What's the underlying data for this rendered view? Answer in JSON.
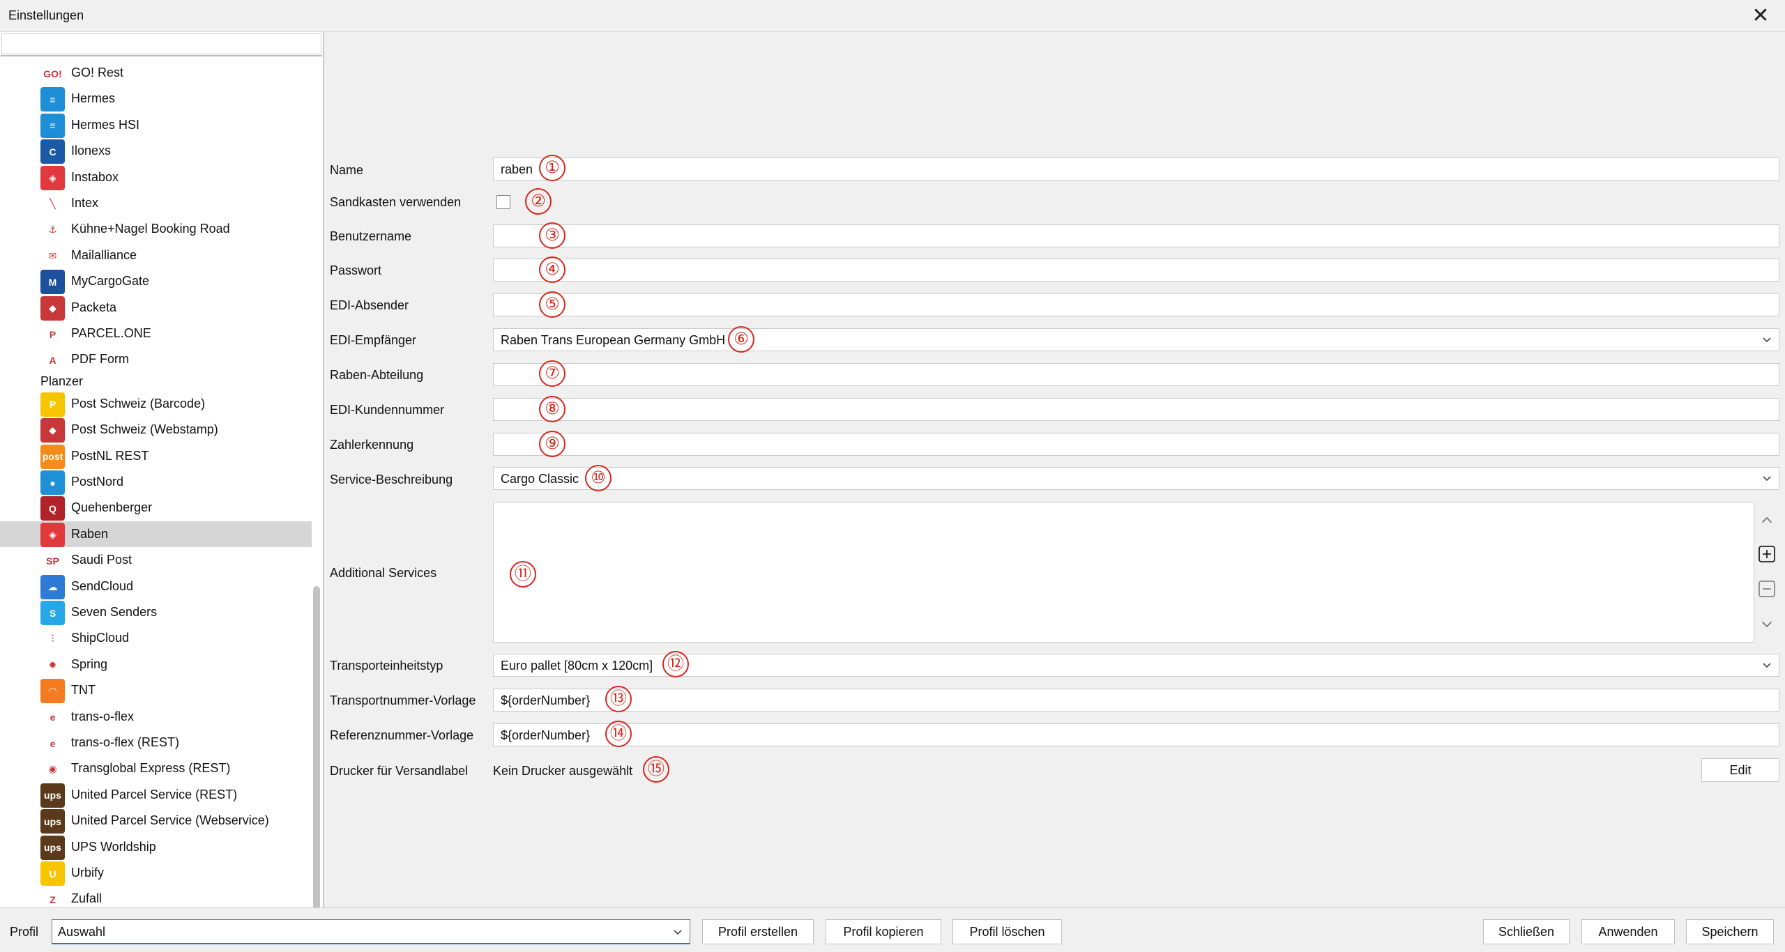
{
  "window": {
    "title": "Einstellungen",
    "close_glyph": "✕"
  },
  "sidebar": {
    "items": [
      {
        "label": "GO! Rest",
        "icon": "go-logo-icon",
        "color": "#ffffff",
        "glyph": "GO!"
      },
      {
        "label": "Hermes",
        "icon": "hermes-logo-icon",
        "color": "#1e8fd6",
        "glyph": "≡"
      },
      {
        "label": "Hermes HSI",
        "icon": "hermes-logo-icon",
        "color": "#1e8fd6",
        "glyph": "≡"
      },
      {
        "label": "Ilonexs",
        "icon": "ilonexs-logo-icon",
        "color": "#1c5aa8",
        "glyph": "C"
      },
      {
        "label": "Instabox",
        "icon": "instabox-logo-icon",
        "color": "#e0393e",
        "glyph": "◈"
      },
      {
        "label": "Intex",
        "icon": "intex-logo-icon",
        "color": "#ffffff",
        "glyph": "╲"
      },
      {
        "label": "Kühne+Nagel Booking Road",
        "icon": "kuehne-nagel-logo-icon",
        "color": "#ffffff",
        "glyph": "⚓"
      },
      {
        "label": "Mailalliance",
        "icon": "mail-logo-icon",
        "color": "#ffffff",
        "glyph": "✉"
      },
      {
        "label": "MyCargoGate",
        "icon": "mycargogate-logo-icon",
        "color": "#1c4f9c",
        "glyph": "M"
      },
      {
        "label": "Packeta",
        "icon": "packeta-logo-icon",
        "color": "#c8373a",
        "glyph": "◆"
      },
      {
        "label": "PARCEL.ONE",
        "icon": "parcelone-logo-icon",
        "color": "#ffffff",
        "glyph": "P"
      },
      {
        "label": "PDF Form",
        "icon": "pdf-logo-icon",
        "color": "#ffffff",
        "glyph": "A"
      },
      {
        "label": "Post Schweiz (Barcode)",
        "icon": "post-schweiz-logo-icon",
        "color": "#f6c500",
        "glyph": "P"
      },
      {
        "label": "Post Schweiz (Webstamp)",
        "icon": "post-schweiz-logo-icon",
        "color": "#c8373a",
        "glyph": "◆"
      },
      {
        "label": "PostNL REST",
        "icon": "postnl-logo-icon",
        "color": "#f28c1a",
        "glyph": "post"
      },
      {
        "label": "PostNord",
        "icon": "postnord-logo-icon",
        "color": "#1e90d6",
        "glyph": "●"
      },
      {
        "label": "Quehenberger",
        "icon": "quehenberger-logo-icon",
        "color": "#b0232a",
        "glyph": "Q"
      },
      {
        "label": "Raben",
        "icon": "raben-logo-icon",
        "color": "#e0393e",
        "glyph": "◈"
      },
      {
        "label": "Saudi Post",
        "icon": "saudi-post-logo-icon",
        "color": "#ffffff",
        "glyph": "SP"
      },
      {
        "label": "SendCloud",
        "icon": "sendcloud-logo-icon",
        "color": "#2d7bd6",
        "glyph": "☁"
      },
      {
        "label": "Seven Senders",
        "icon": "seven-senders-logo-icon",
        "color": "#27a7e6",
        "glyph": "S"
      },
      {
        "label": "ShipCloud",
        "icon": "shipcloud-logo-icon",
        "color": "#ffffff",
        "glyph": "⫶"
      },
      {
        "label": "Spring",
        "icon": "spring-logo-icon",
        "color": "#ffffff",
        "glyph": "✹"
      },
      {
        "label": "TNT",
        "icon": "tnt-logo-icon",
        "color": "#f47b20",
        "glyph": "◠"
      },
      {
        "label": "trans-o-flex",
        "icon": "trans-o-flex-logo-icon",
        "color": "#ffffff",
        "glyph": "e"
      },
      {
        "label": "trans-o-flex (REST)",
        "icon": "trans-o-flex-logo-icon",
        "color": "#ffffff",
        "glyph": "e"
      },
      {
        "label": "Transglobal Express (REST)",
        "icon": "transglobal-logo-icon",
        "color": "#ffffff",
        "glyph": "◉"
      },
      {
        "label": "United Parcel Service (REST)",
        "icon": "ups-logo-icon",
        "color": "#5a3a1a",
        "glyph": "ups"
      },
      {
        "label": "United Parcel Service (Webservice)",
        "icon": "ups-logo-icon",
        "color": "#5a3a1a",
        "glyph": "ups"
      },
      {
        "label": "UPS Worldship",
        "icon": "ups-logo-icon",
        "color": "#5a3a1a",
        "glyph": "ups"
      },
      {
        "label": "Urbify",
        "icon": "urbify-logo-icon",
        "color": "#f6c500",
        "glyph": "U"
      },
      {
        "label": "Zufall",
        "icon": "zufall-logo-icon",
        "color": "#ffffff",
        "glyph": "Z"
      }
    ],
    "group_label": "Planzer",
    "selected": "Raben"
  },
  "form": {
    "name_label": "Name",
    "name_value": "raben",
    "sandbox_label": "Sandkasten verwenden",
    "username_label": "Benutzername",
    "password_label": "Passwort",
    "edi_sender_label": "EDI-Absender",
    "edi_receiver_label": "EDI-Empfänger",
    "edi_receiver_value": "Raben Trans European Germany GmbH",
    "raben_department_label": "Raben-Abteilung",
    "edi_customer_number_label": "EDI-Kundennummer",
    "payer_id_label": "Zahlerkennung",
    "service_description_label": "Service-Beschreibung",
    "service_description_value": "Cargo Classic",
    "additional_services_label": "Additional Services",
    "transport_unit_type_label": "Transporteinheitstyp",
    "transport_unit_type_value": "Euro pallet [80cm x 120cm]",
    "transport_number_template_label": "Transportnummer-Vorlage",
    "transport_number_template_value": "${orderNumber}",
    "reference_number_template_label": "Referenznummer-Vorlage",
    "reference_number_template_value": "${orderNumber}",
    "printer_label": "Drucker für Versandlabel",
    "printer_value": "Kein Drucker ausgewählt",
    "edit_label": "Edit"
  },
  "markers": [
    "①",
    "②",
    "③",
    "④",
    "⑤",
    "⑥",
    "⑦",
    "⑧",
    "⑨",
    "⑩",
    "⑪",
    "⑫",
    "⑬",
    "⑭",
    "⑮"
  ],
  "bottom": {
    "profile_label": "Profil",
    "profile_value": "Auswahl",
    "create_profile": "Profil erstellen",
    "copy_profile": "Profil kopieren",
    "delete_profile": "Profil löschen",
    "close": "Schließen",
    "apply": "Anwenden",
    "save": "Speichern"
  },
  "colors": {
    "marker": "#d9261c",
    "selection": "#d6d6d6",
    "focus": "#2a6fd6"
  }
}
